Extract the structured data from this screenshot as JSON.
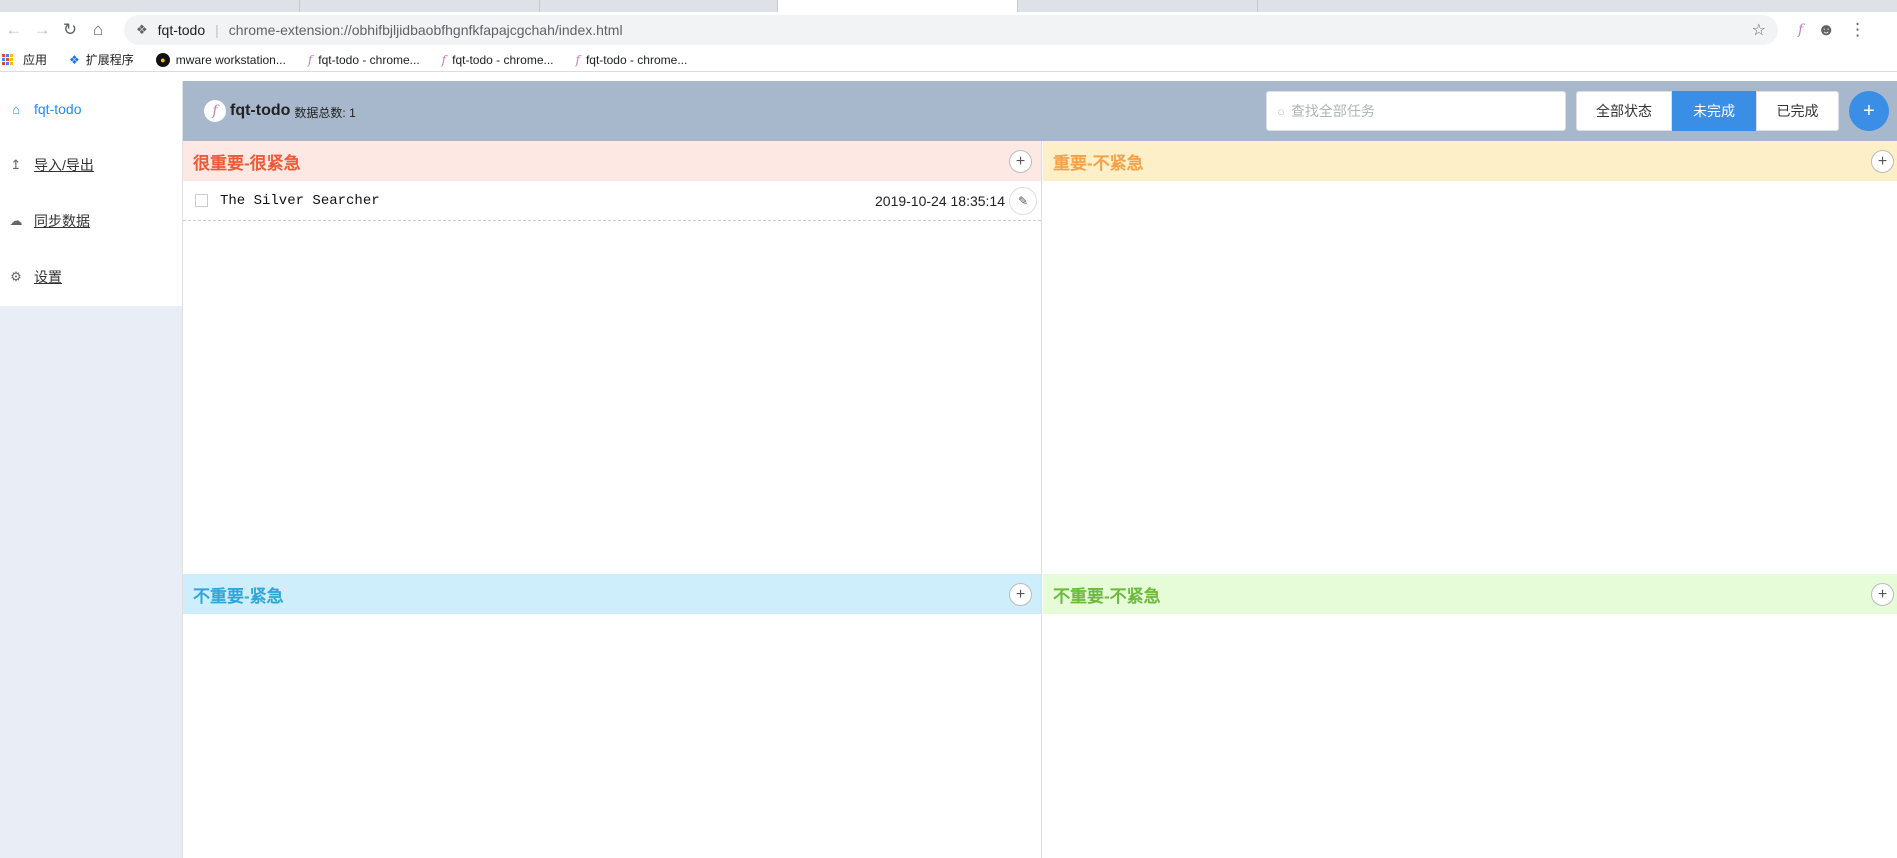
{
  "browser": {
    "site_name": "fqt-todo",
    "url": "chrome-extension://obhifbjljidbaobfhgnfkfapajcgchah/index.html",
    "bookmarks": [
      {
        "label": "应用",
        "icon": "apps-grid-icon"
      },
      {
        "label": "扩展程序",
        "icon": "puzzle-icon"
      },
      {
        "label": "mware workstation...",
        "icon": "vmware-icon"
      },
      {
        "label": "fqt-todo - chrome...",
        "icon": "fqt-icon"
      },
      {
        "label": "fqt-todo - chrome...",
        "icon": "fqt-icon"
      },
      {
        "label": "fqt-todo - chrome...",
        "icon": "fqt-icon"
      }
    ]
  },
  "sidebar": {
    "items": [
      {
        "label": "fqt-todo",
        "icon": "home-icon",
        "active": true
      },
      {
        "label": "导入/导出",
        "icon": "upload-icon",
        "active": false
      },
      {
        "label": "同步数据",
        "icon": "cloud-upload-icon",
        "active": false
      },
      {
        "label": "设置",
        "icon": "gear-icon",
        "active": false
      }
    ]
  },
  "header": {
    "title": "fqt-todo",
    "count_label": "数据总数: 1",
    "search_placeholder": "查找全部任务",
    "filters": [
      "全部状态",
      "未完成",
      "已完成"
    ],
    "active_filter": "未完成",
    "add_label": "+"
  },
  "quadrants": [
    {
      "title": "很重要-很紧急",
      "color": "#ee5a38",
      "tasks": [
        {
          "title": "The Silver Searcher",
          "time": "2019-10-24 18:35:14",
          "done": false
        }
      ]
    },
    {
      "title": "重要-不紧急",
      "color": "#f4a24a",
      "tasks": []
    },
    {
      "title": "不重要-紧急",
      "color": "#2fa6d8",
      "tasks": []
    },
    {
      "title": "不重要-不紧急",
      "color": "#6cba3b",
      "tasks": []
    }
  ],
  "colors": {
    "accent": "#3a8ee6",
    "header_bg": "#a8b8cc",
    "sidebar_bg": "#e9edf5"
  }
}
